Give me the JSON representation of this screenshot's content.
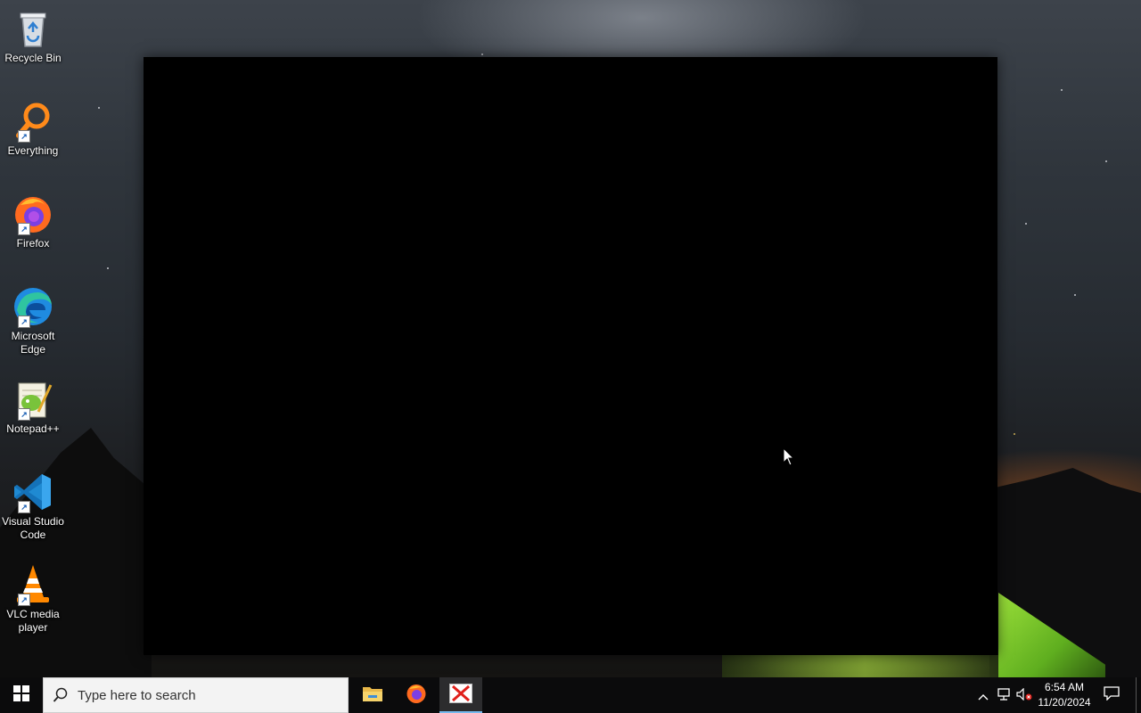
{
  "desktop": {
    "icons": [
      {
        "label": "Recycle Bin",
        "icon": "recycle-bin-icon"
      },
      {
        "label": "Everything",
        "icon": "everything-search-icon"
      },
      {
        "label": "Firefox",
        "icon": "firefox-icon"
      },
      {
        "label": "Microsoft Edge",
        "icon": "edge-icon"
      },
      {
        "label": "Notepad++",
        "icon": "notepad-plus-plus-icon"
      },
      {
        "label": "Visual Studio Code",
        "icon": "vscode-icon"
      },
      {
        "label": "VLC media player",
        "icon": "vlc-icon"
      }
    ]
  },
  "taskbar": {
    "search_placeholder": "Type here to search",
    "pinned": [
      {
        "name": "File Explorer",
        "icon": "folder-icon"
      },
      {
        "name": "Firefox",
        "icon": "firefox-icon"
      },
      {
        "name": "Active app",
        "icon": "red-x-icon",
        "active": true
      }
    ],
    "clock": {
      "time": "6:54 AM",
      "date": "11/20/2024"
    }
  },
  "colors": {
    "taskbar_bg": "#0b0b0c",
    "active_indicator": "#76b9ed",
    "search_bg": "#f3f3f3"
  }
}
